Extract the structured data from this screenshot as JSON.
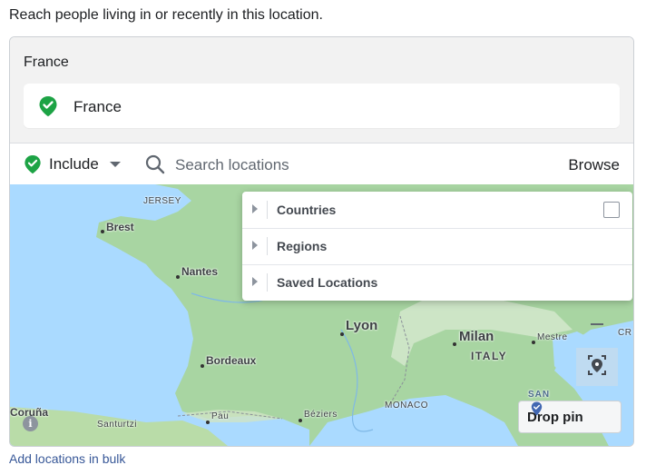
{
  "intro_text": "Reach people living in or recently in this location.",
  "selected_group": {
    "heading": "France",
    "chip_label": "France",
    "chip_icon": "location-pin-check-icon"
  },
  "search_bar": {
    "include_label": "Include",
    "placeholder": "Search locations",
    "browse_label": "Browse"
  },
  "browse_menu": {
    "items": [
      {
        "label": "Countries",
        "has_checkbox": true
      },
      {
        "label": "Regions",
        "has_checkbox": false
      },
      {
        "label": "Saved Locations",
        "has_checkbox": false
      }
    ]
  },
  "map": {
    "labels": {
      "jersey": "JERSEY",
      "brest": "Brest",
      "nantes": "Nantes",
      "lyon": "Lyon",
      "milan": "Milan",
      "mestre": "Mestre",
      "italy": "ITALY",
      "bordeaux": "Bordeaux",
      "pau": "Pau",
      "beziers": "Béziers",
      "monaco": "MONACO",
      "san": "SAN",
      "coruna": "Coruña",
      "santurtzi": "Santurtzi",
      "cr": "CR"
    },
    "drop_pin_label": "Drop pin",
    "info_glyph": "i"
  },
  "bulk_link": "Add locations in bulk",
  "colors": {
    "include_green": "#1da345",
    "link_blue": "#385898",
    "sea": "#aadaff",
    "land": "#a8d5a2"
  }
}
